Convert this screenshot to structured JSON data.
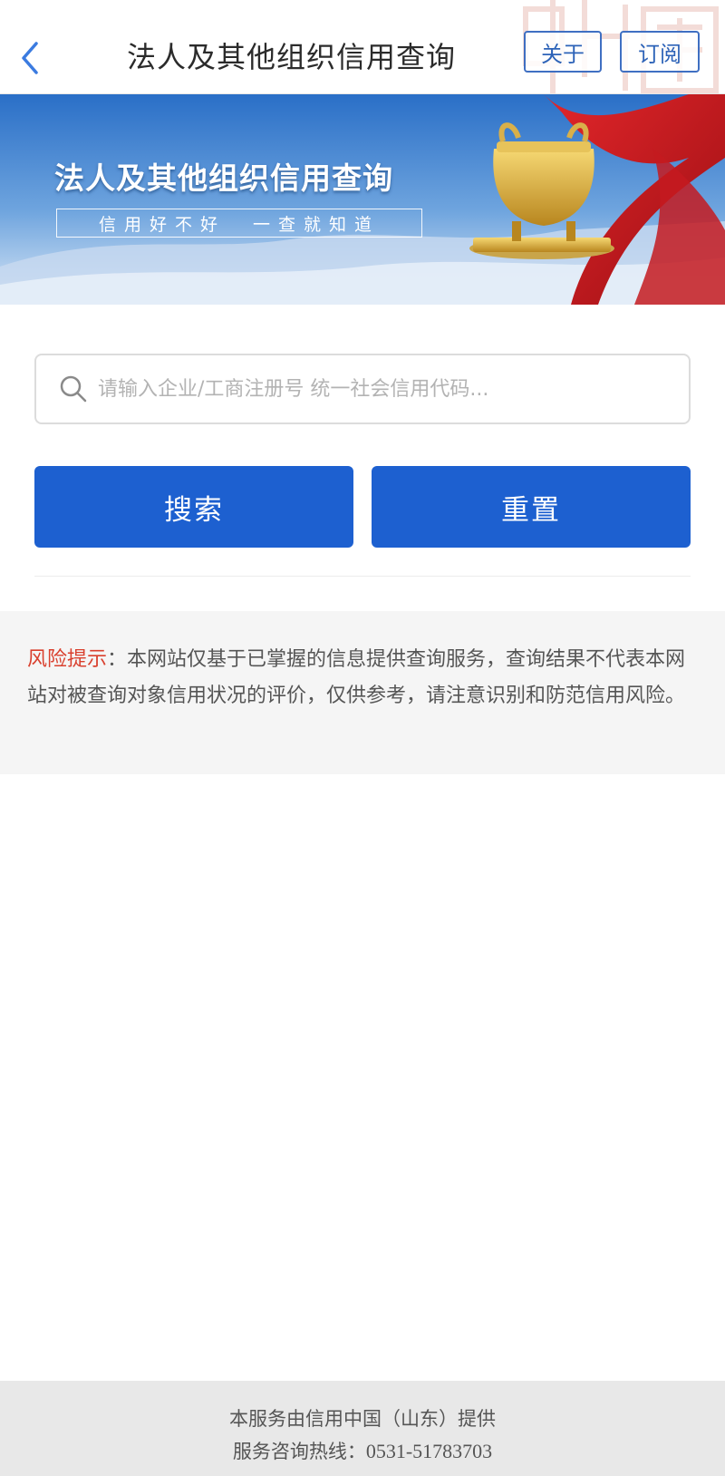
{
  "header": {
    "title": "法人及其他组织信用查询",
    "back_icon": "chevron-left-icon",
    "about_label": "关于",
    "subscribe_label": "订阅",
    "accent_color": "#2d63b8"
  },
  "banner": {
    "title": "法人及其他组织信用查询",
    "slogan": "信用好不好  一查就知道"
  },
  "search": {
    "icon": "search-icon",
    "placeholder": "请输入企业/工商注册号 统一社会信用代码..."
  },
  "actions": {
    "search_label": "搜索",
    "reset_label": "重置",
    "button_color": "#1d60d0"
  },
  "risk": {
    "label": "风险提示",
    "text": "：本网站仅基于已掌握的信息提供查询服务，查询结果不代表本网站对被查询对象信用状况的评价，仅供参考，请注意识别和防范信用风险。",
    "label_color": "#d9402e"
  },
  "footer": {
    "provider": "本服务由信用中国（山东）提供",
    "hotline_label": "服务咨询热线：",
    "hotline_number": "0531-51783703"
  }
}
